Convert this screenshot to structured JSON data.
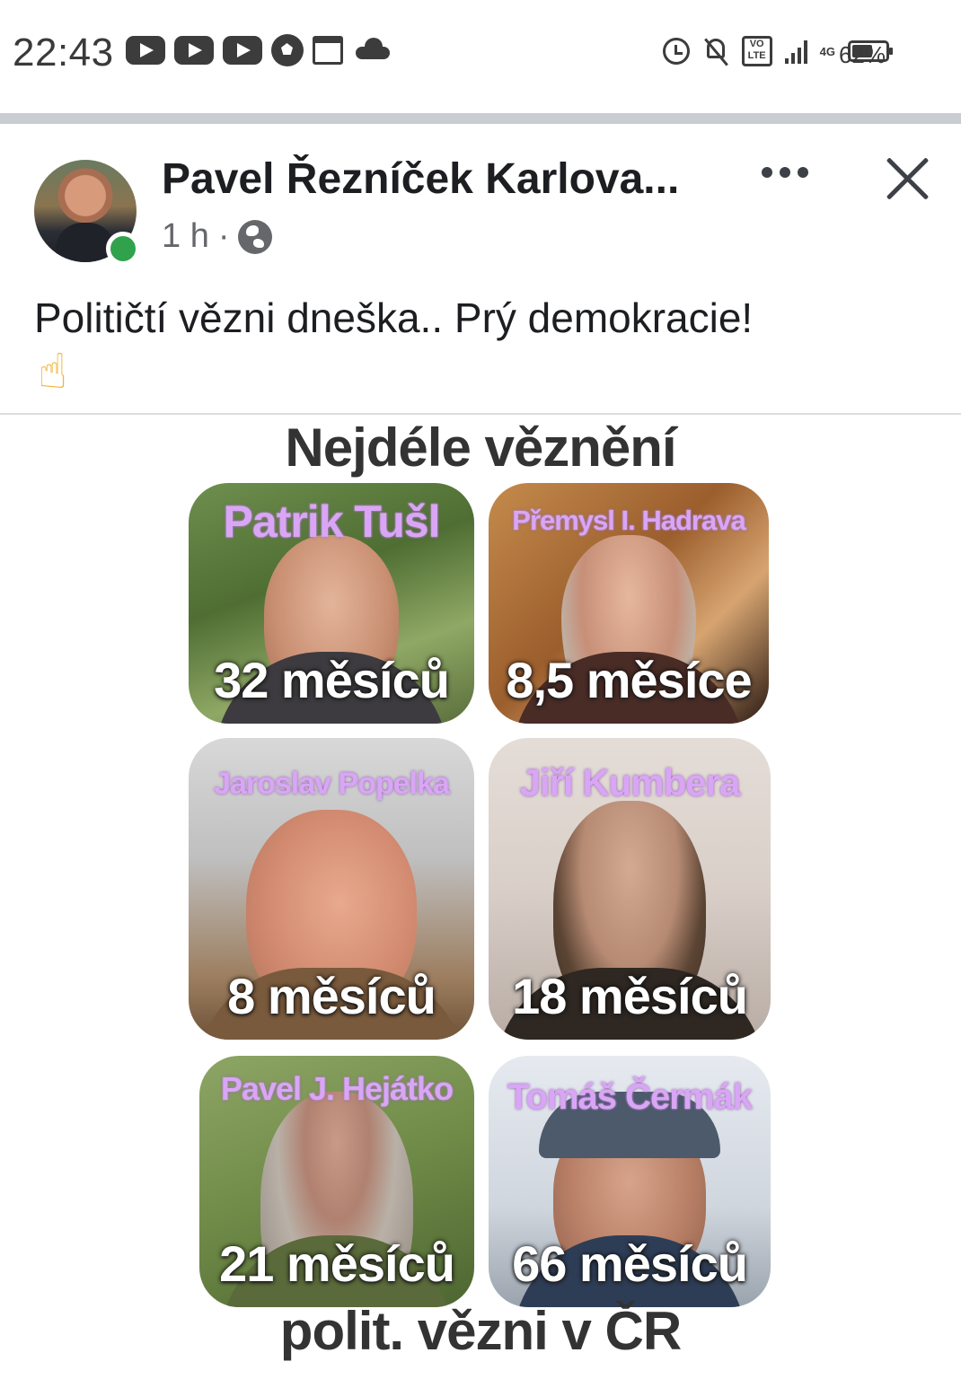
{
  "status_bar": {
    "time": "22:43",
    "left_icons": [
      "youtube-icon",
      "youtube-icon",
      "youtube-icon",
      "soccer-ball-icon",
      "calendar-icon",
      "cloud-icon"
    ],
    "right_icons": [
      "alarm-icon",
      "muted-bell-icon",
      "volte-icon",
      "signal-icon",
      "4g-icon",
      "battery-icon"
    ],
    "volte_label": "VO LTE",
    "network": "4G",
    "battery_percent": "62%",
    "battery_level": 0.62
  },
  "post": {
    "author": "Pavel Řezníček Karlova...",
    "time_ago": "1 h",
    "separator": "·",
    "privacy_icon": "globe-icon",
    "online": true,
    "text": "Političtí vězni dneška.. Prý demokracie!",
    "emoji": "☝",
    "accent_online": "#31a24c"
  },
  "graphic": {
    "title": "Nejdéle věznění",
    "footer": "polit. vězni v ČR",
    "prisoners": [
      {
        "name": "Patrik Tušl",
        "duration": "32 měsíců"
      },
      {
        "name": "Přemysl I. Hadrava",
        "duration": "8,5 měsíce"
      },
      {
        "name": "Jaroslav Popelka",
        "duration": "8 měsíců"
      },
      {
        "name": "Jiří Kumbera",
        "duration": "18 měsíců"
      },
      {
        "name": "Pavel J. Hejátko",
        "duration": "21 měsíců"
      },
      {
        "name": "Tomáš Čermák",
        "duration": "66 měsíců"
      }
    ],
    "name_color": "#d9a6f5"
  }
}
